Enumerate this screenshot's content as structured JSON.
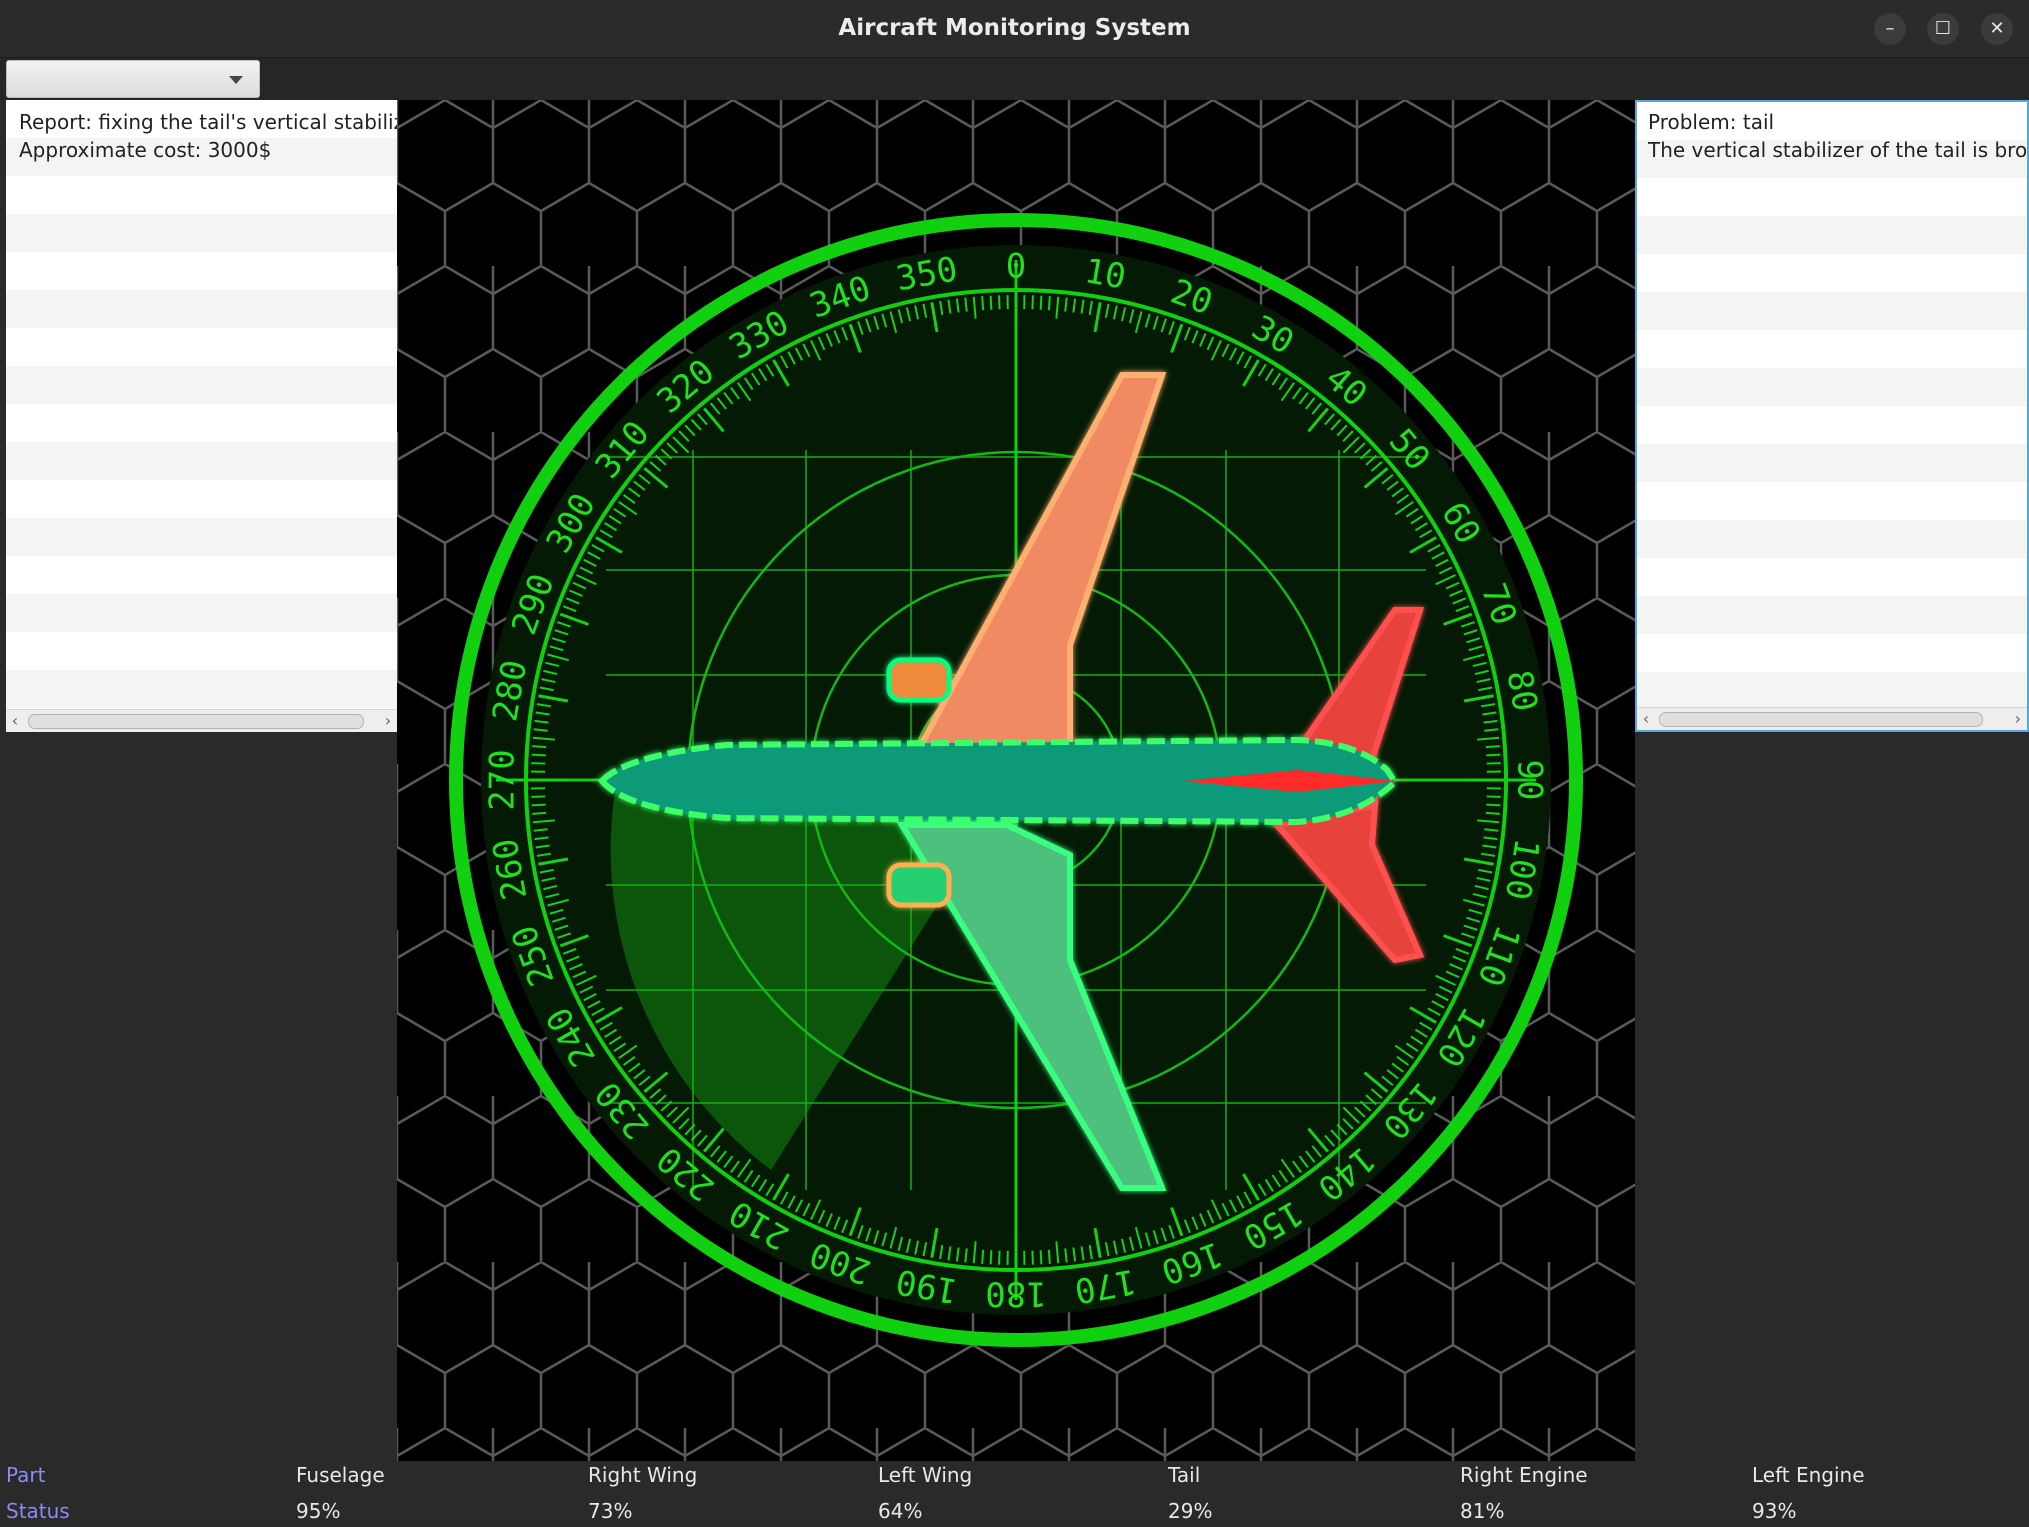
{
  "window": {
    "title": "Aircraft Monitoring System",
    "minimize_glyph": "–",
    "maximize_glyph": "☐",
    "close_glyph": "✕"
  },
  "toolbar": {
    "combo_value": ""
  },
  "report_panel": {
    "lines": [
      "Report: fixing the tail's vertical stabilizer",
      "Approximate cost: 3000$"
    ]
  },
  "problem_panel": {
    "lines": [
      "Problem: tail",
      "The vertical stabilizer of the tail is broken"
    ]
  },
  "compass": {
    "heading_labels": [
      "0",
      "10",
      "20",
      "30",
      "40",
      "50",
      "60",
      "70",
      "80",
      "90",
      "100",
      "110",
      "120",
      "130",
      "140",
      "150",
      "160",
      "170",
      "180",
      "190",
      "200",
      "210",
      "220",
      "230",
      "240",
      "250",
      "260",
      "270",
      "280",
      "290",
      "300",
      "310",
      "320",
      "330",
      "340",
      "350"
    ],
    "ring_color": "#10d010",
    "grid_color": "#14b814"
  },
  "aircraft": {
    "parts": [
      {
        "name": "Right Wing",
        "color": "#f08a62"
      },
      {
        "name": "Left Wing",
        "color": "#4ec07e"
      },
      {
        "name": "Fuselage",
        "color": "#0d9a78"
      },
      {
        "name": "Tail",
        "color": "#e8423e"
      },
      {
        "name": "Right Engine",
        "color": "#f08a3a"
      },
      {
        "name": "Left Engine",
        "color": "#28d070"
      }
    ]
  },
  "status_table": {
    "part_label": "Part",
    "status_label": "Status",
    "columns": [
      {
        "part": "Fuselage",
        "status": "95%"
      },
      {
        "part": "Right Wing",
        "status": "73%"
      },
      {
        "part": "Left Wing",
        "status": "64%"
      },
      {
        "part": "Tail",
        "status": "29%"
      },
      {
        "part": "Right Engine",
        "status": "81%"
      },
      {
        "part": "Left Engine",
        "status": "93%"
      }
    ]
  }
}
